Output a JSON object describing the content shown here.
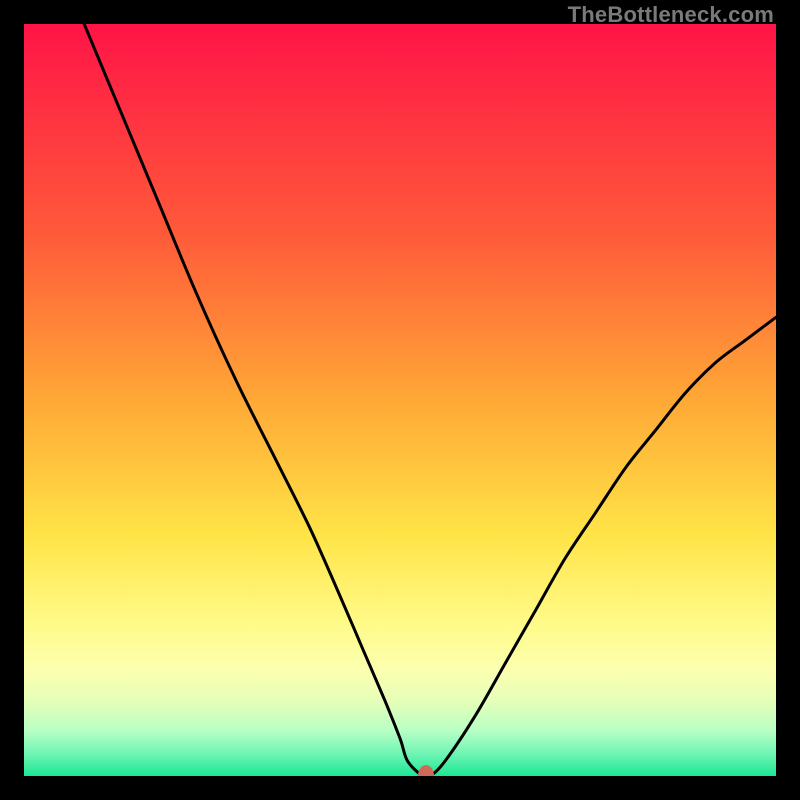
{
  "watermark": "TheBottleneck.com",
  "chart_data": {
    "type": "line",
    "title": "",
    "xlabel": "",
    "ylabel": "",
    "xlim": [
      0,
      100
    ],
    "ylim": [
      0,
      100
    ],
    "note": "V-shaped bottleneck curve over a red→yellow→green vertical gradient. Values estimated from pixel positions.",
    "x": [
      8,
      13,
      18,
      23,
      28,
      33,
      38,
      42,
      45,
      48,
      50,
      51,
      53,
      54,
      56,
      60,
      64,
      68,
      72,
      76,
      80,
      84,
      88,
      92,
      96,
      100
    ],
    "values": [
      100,
      88,
      76,
      64,
      53,
      43,
      33,
      24,
      17,
      10,
      5,
      2,
      0,
      0,
      2,
      8,
      15,
      22,
      29,
      35,
      41,
      46,
      51,
      55,
      58,
      61
    ],
    "marker": {
      "x": 53.5,
      "y": 0,
      "color": "#d06a58"
    },
    "gradient_stops": [
      {
        "offset": 0.0,
        "color": "#ff1447"
      },
      {
        "offset": 0.28,
        "color": "#ff5a3a"
      },
      {
        "offset": 0.5,
        "color": "#ffa836"
      },
      {
        "offset": 0.68,
        "color": "#ffe447"
      },
      {
        "offset": 0.8,
        "color": "#fffb8a"
      },
      {
        "offset": 0.86,
        "color": "#fbffb0"
      },
      {
        "offset": 0.9,
        "color": "#e6ffb8"
      },
      {
        "offset": 0.94,
        "color": "#b8ffc4"
      },
      {
        "offset": 0.97,
        "color": "#70f5b4"
      },
      {
        "offset": 1.0,
        "color": "#1ce695"
      }
    ]
  }
}
